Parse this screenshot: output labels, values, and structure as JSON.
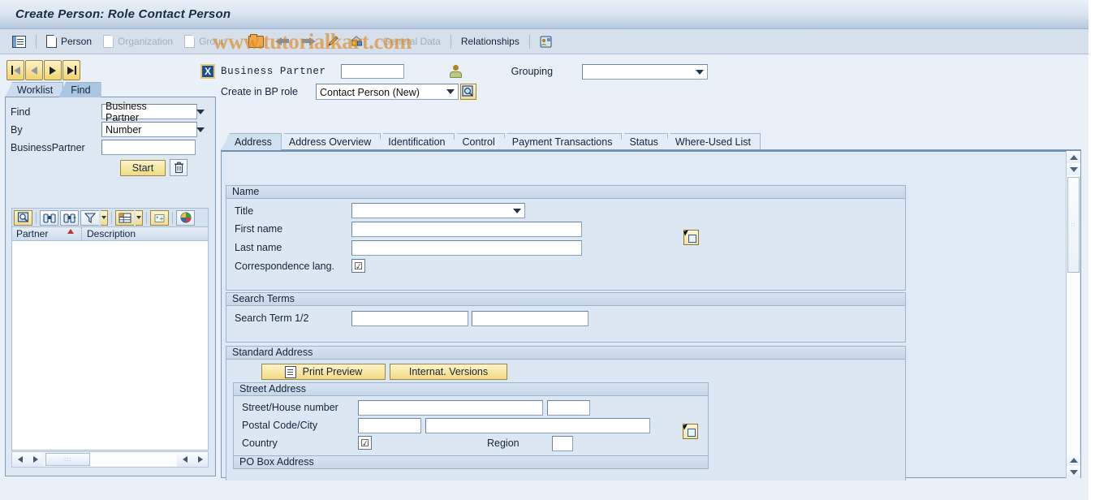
{
  "window": {
    "title": "Create Person: Role Contact Person",
    "watermark": "www.tutorialkart.com"
  },
  "function_toolbar": {
    "items": [
      {
        "name": "list-display",
        "label": "",
        "icon": "list-icon",
        "enabled": true
      },
      {
        "name": "person",
        "label": "Person",
        "icon": "document-icon",
        "enabled": true
      },
      {
        "name": "organization",
        "label": "Organization",
        "icon": "document-icon",
        "enabled": false
      },
      {
        "name": "group",
        "label": "Group",
        "icon": "document-icon",
        "enabled": false
      },
      {
        "name": "open",
        "label": "",
        "icon": "open-folder-icon",
        "enabled": true
      },
      {
        "name": "back",
        "label": "",
        "icon": "arrow-left-icon",
        "enabled": true
      },
      {
        "name": "forward",
        "label": "",
        "icon": "arrow-right-icon",
        "enabled": true
      },
      {
        "name": "edit",
        "label": "",
        "icon": "pencil-icon",
        "enabled": true
      },
      {
        "name": "lock",
        "label": "",
        "icon": "lock-house-icon",
        "enabled": true
      },
      {
        "name": "general-data",
        "label": "General Data",
        "icon": "",
        "enabled": false
      },
      {
        "name": "relationships",
        "label": "Relationships",
        "icon": "",
        "enabled": true
      },
      {
        "name": "relationship-card",
        "label": "",
        "icon": "relationship-card-icon",
        "enabled": true
      }
    ]
  },
  "navigation": {
    "first": "first-record",
    "previous": "previous-record",
    "next": "next-record",
    "last": "last-record"
  },
  "bp_header": {
    "business_partner_label": "Business Partner",
    "business_partner_value": "",
    "grouping_label": "Grouping",
    "grouping_value": "",
    "create_in_bp_role_label": "Create in BP role",
    "create_in_bp_role_value": "Contact Person (New)",
    "role_options": [
      "Contact Person (New)"
    ]
  },
  "left_panel": {
    "tabs": [
      {
        "label": "Worklist",
        "active": false
      },
      {
        "label": "Find",
        "active": true
      }
    ],
    "find_form": {
      "find_label": "Find",
      "find_value": "Business Partner",
      "find_options": [
        "Business Partner"
      ],
      "by_label": "By",
      "by_value": "Number",
      "by_options": [
        "Number"
      ],
      "partner_label": "BusinessPartner",
      "partner_value": "",
      "start_button": "Start",
      "delete_button_icon": "trash-icon"
    },
    "grid_toolbar": [
      {
        "name": "details",
        "icon": "magnifier-details-icon"
      },
      {
        "name": "find",
        "icon": "binoculars-icon"
      },
      {
        "name": "find-next",
        "icon": "binoculars-next-icon"
      },
      {
        "name": "filter",
        "icon": "filter-icon",
        "has_dropdown": true
      },
      {
        "name": "layout",
        "icon": "table-layout-icon",
        "has_dropdown": true
      },
      {
        "name": "refresh",
        "icon": "sparkle-icon"
      },
      {
        "name": "color-palette",
        "icon": "color-palette-icon"
      }
    ],
    "grid": {
      "columns": [
        "Partner",
        "Description"
      ],
      "rows": [],
      "sort_column": "Partner"
    }
  },
  "main_panel": {
    "tabs": [
      {
        "label": "Address",
        "active": true
      },
      {
        "label": "Address Overview",
        "active": false
      },
      {
        "label": "Identification",
        "active": false
      },
      {
        "label": "Control",
        "active": false
      },
      {
        "label": "Payment Transactions",
        "active": false
      },
      {
        "label": "Status",
        "active": false
      },
      {
        "label": "Where-Used List",
        "active": false
      }
    ],
    "name_group": {
      "header": "Name",
      "title_label": "Title",
      "title_value": "",
      "first_name_label": "First name",
      "first_name_value": "",
      "last_name_label": "Last name",
      "last_name_value": "",
      "correspondence_lang_label": "Correspondence lang.",
      "correspondence_lang_value": ""
    },
    "search_terms_group": {
      "header": "Search Terms",
      "search_term_label": "Search Term 1/2",
      "search_term_1": "",
      "search_term_2": ""
    },
    "standard_address_group": {
      "header": "Standard Address",
      "print_preview_button": "Print Preview",
      "internat_versions_button": "Internat. Versions",
      "street_address": {
        "header": "Street Address",
        "street_house_label": "Street/House number",
        "street_value": "",
        "house_number_value": "",
        "postal_city_label": "Postal Code/City",
        "postal_code_value": "",
        "city_value": "",
        "country_label": "Country",
        "country_value": "",
        "region_label": "Region",
        "region_value": ""
      },
      "po_box_address": {
        "header": "PO Box Address"
      }
    }
  },
  "colors": {
    "title_text": "#1a2b44",
    "panel_bg": "#dfeaf5",
    "toolbar_bg": "#d6e0ec",
    "button_yellow": "#f7e7a4",
    "accent_blue": "#1b4f9c",
    "watermark": "#e08414"
  }
}
